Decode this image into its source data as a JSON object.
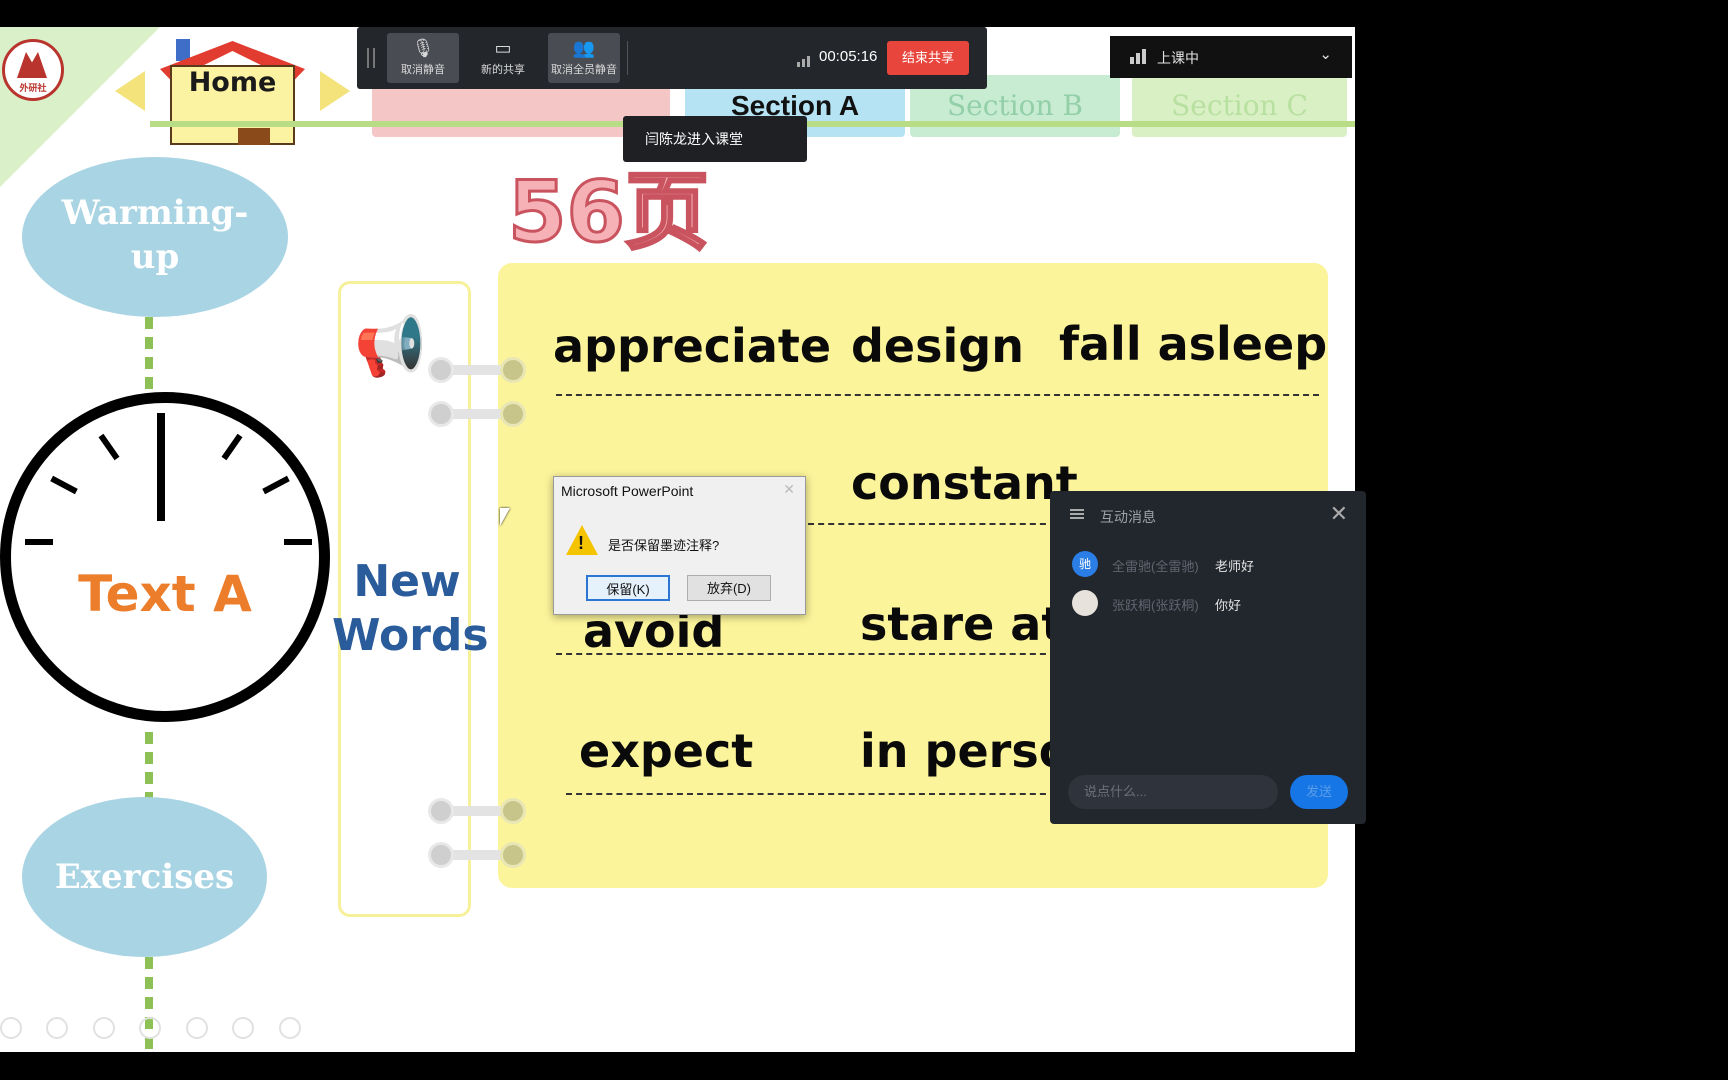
{
  "slide": {
    "logo_text": "外研社",
    "home_label": "Home",
    "section_tabs": [
      "Section A",
      "Section B",
      "Section C"
    ],
    "page_number": "56页",
    "warmup_label": "Warming-\nup",
    "text_a_label": "Text A",
    "new_words_label": "New\nWords",
    "exercises_label": "Exercises",
    "words": [
      "appreciate",
      "design",
      "fall asleep",
      "constant",
      "avoid",
      "stare at",
      "expect",
      "in perso"
    ]
  },
  "toolbar": {
    "mute_label": "取消静音",
    "new_share_label": "新的共享",
    "mute_all_label": "取消全员静音",
    "timer": "00:05:16",
    "end_share_label": "结束共享"
  },
  "status": {
    "label": "上课中"
  },
  "toast": {
    "text": "闫陈龙进入课堂"
  },
  "dialog": {
    "title": "Microsoft PowerPoint",
    "message": "是否保留墨迹注释?",
    "keep_label": "保留(K)",
    "discard_label": "放弃(D)"
  },
  "chat": {
    "title": "互动消息",
    "messages": [
      {
        "avatar": "驰",
        "name": "全雷驰(全雷驰)",
        "text": "老师好"
      },
      {
        "avatar": "",
        "name": "张跃桐(张跃桐)",
        "text": "你好"
      }
    ],
    "input_placeholder": "说点什么...",
    "send_label": "发送"
  },
  "colors": {
    "end_share": "#e8453c",
    "send": "#1676e5",
    "board": "#fbf49a"
  },
  "icons": [
    "microphone-icon",
    "share-screen-icon",
    "mute-all-icon",
    "signal-icon",
    "chevron-down-icon",
    "warning-icon",
    "menu-icon",
    "close-icon",
    "megaphone-icon"
  ]
}
